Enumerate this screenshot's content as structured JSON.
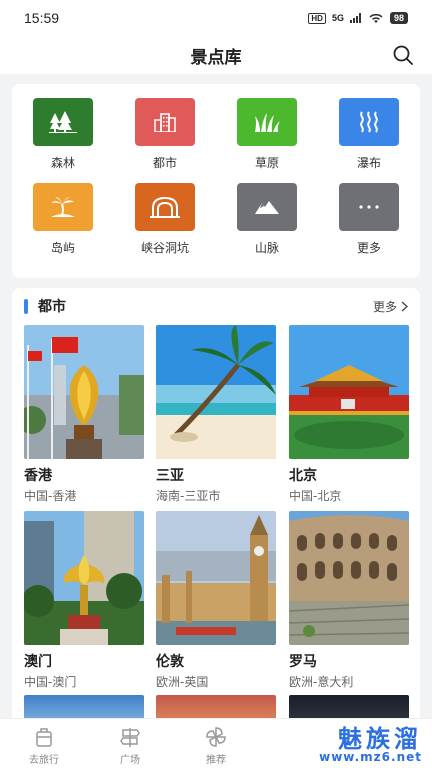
{
  "status_bar": {
    "time": "15:59",
    "hd": "HD",
    "network": "5G",
    "battery": "98"
  },
  "header": {
    "title": "景点库"
  },
  "categories": [
    {
      "label": "森林",
      "icon": "forest-icon",
      "color": "#2e7d2e"
    },
    {
      "label": "都市",
      "icon": "city-icon",
      "color": "#e05a5a"
    },
    {
      "label": "草原",
      "icon": "grassland-icon",
      "color": "#4cb82e"
    },
    {
      "label": "瀑布",
      "icon": "waterfall-icon",
      "color": "#3a86e8"
    },
    {
      "label": "岛屿",
      "icon": "island-icon",
      "color": "#f0a030"
    },
    {
      "label": "峡谷洞坑",
      "icon": "canyon-icon",
      "color": "#d8661e"
    },
    {
      "label": "山脉",
      "icon": "mountain-icon",
      "color": "#6e7075"
    },
    {
      "label": "更多",
      "icon": "more-icon",
      "color": "#6e7075"
    }
  ],
  "city_section": {
    "title": "都市",
    "more": "更多",
    "items": [
      {
        "name": "香港",
        "region": "中国-香港"
      },
      {
        "name": "三亚",
        "region": "海南-三亚市"
      },
      {
        "name": "北京",
        "region": "中国-北京"
      },
      {
        "name": "澳门",
        "region": "中国-澳门"
      },
      {
        "name": "伦敦",
        "region": "欧洲-英国"
      },
      {
        "name": "罗马",
        "region": "欧洲-意大利"
      }
    ]
  },
  "bottom_nav": [
    {
      "label": "去旅行"
    },
    {
      "label": "广场"
    },
    {
      "label": "推荐"
    }
  ],
  "watermark": {
    "text": "魅族溜",
    "url": "www.mz6.net"
  }
}
